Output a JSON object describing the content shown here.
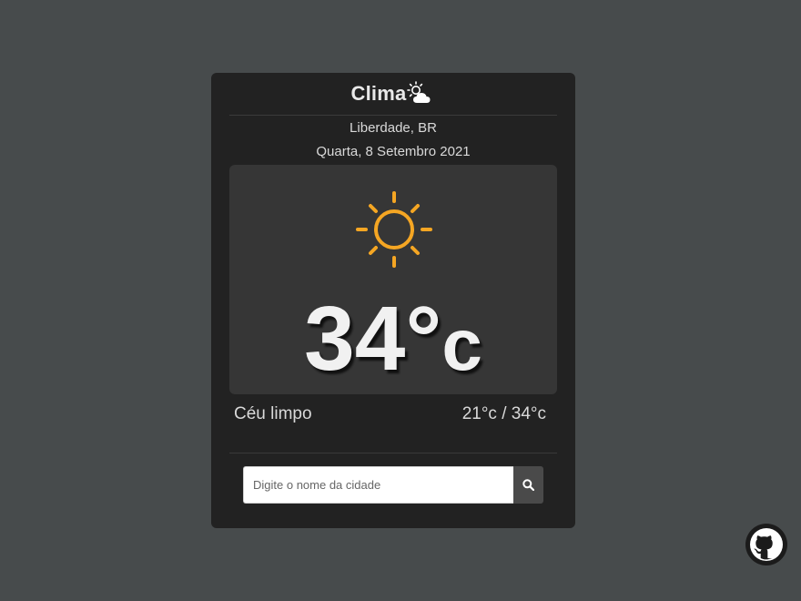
{
  "header": {
    "title": "Clima",
    "icon": "sun-behind-cloud-icon"
  },
  "weather": {
    "location": "Liberdade, BR",
    "date": "Quarta, 8 Setembro 2021",
    "icon": "sun-icon",
    "icon_color": "#f5a623",
    "temperature": "34°",
    "temperature_unit": "c",
    "description": "Céu limpo",
    "min_max": "21°c / 34°c"
  },
  "search": {
    "placeholder": "Digite o nome da cidade",
    "value": "",
    "button_icon": "search-icon"
  },
  "footer": {
    "github_icon": "github-icon"
  },
  "colors": {
    "background": "#474b4c",
    "card": "#222222",
    "panel": "#363636",
    "accent": "#f5a623"
  }
}
